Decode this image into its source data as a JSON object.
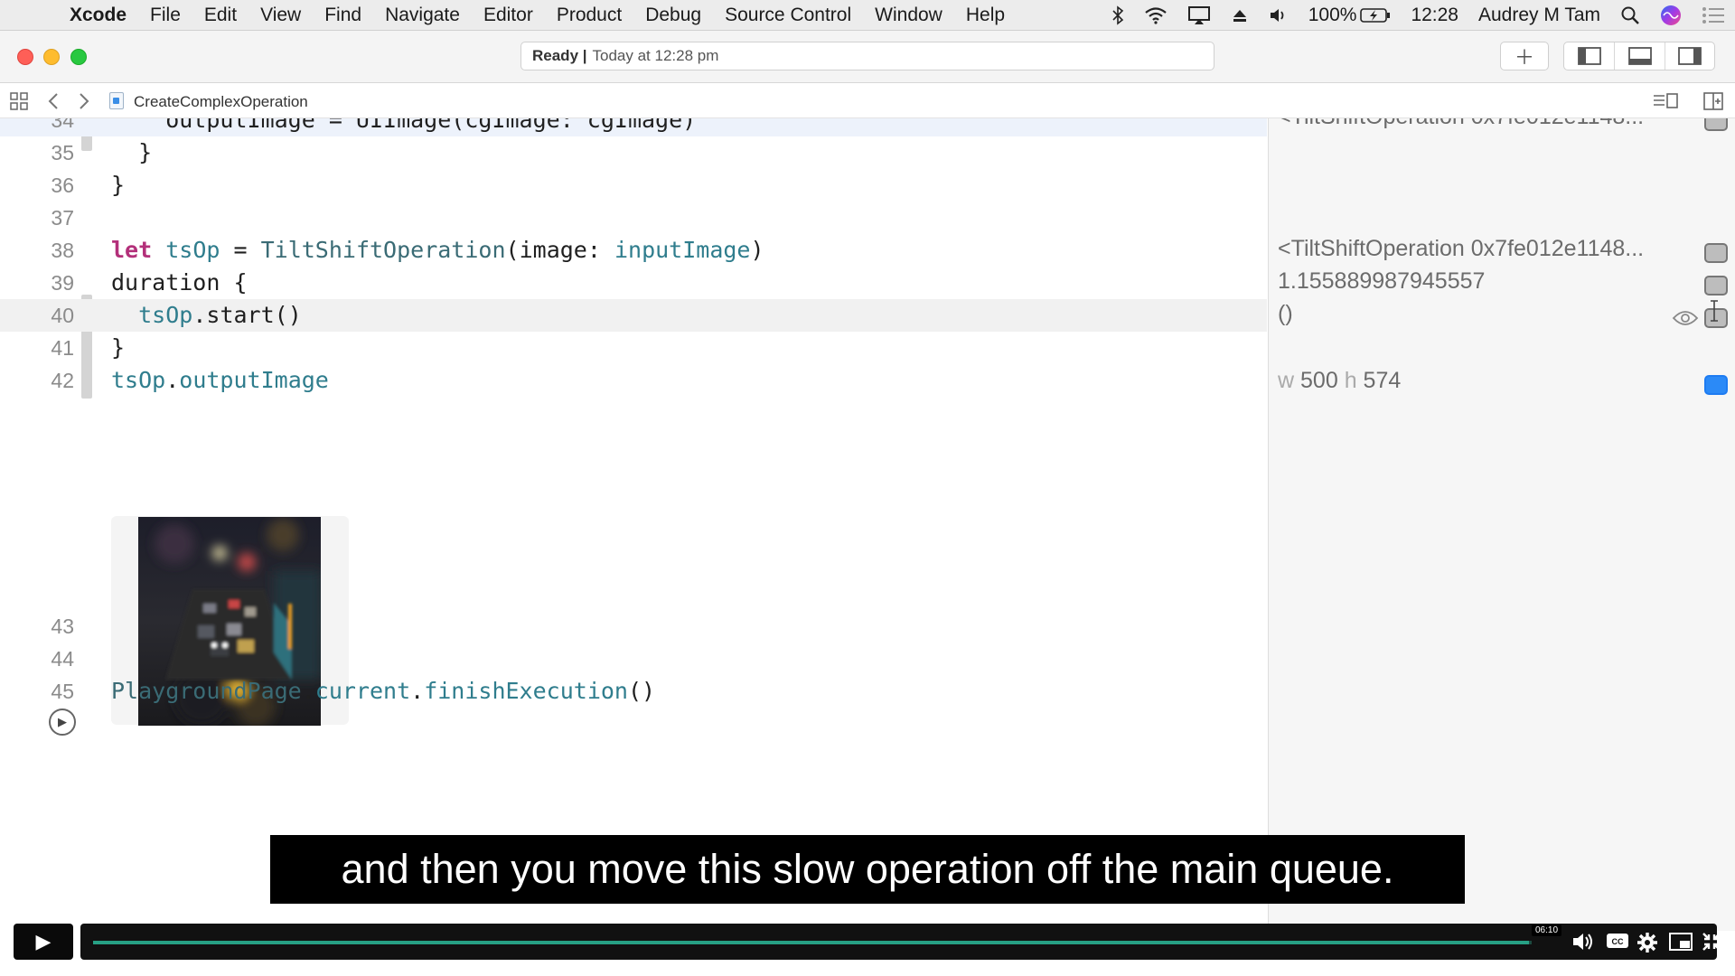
{
  "menubar": {
    "app_name": "Xcode",
    "items": [
      "File",
      "Edit",
      "View",
      "Find",
      "Navigate",
      "Editor",
      "Product",
      "Debug",
      "Source Control",
      "Window",
      "Help"
    ],
    "battery": "100%",
    "clock": "12:28",
    "user": "Audrey M Tam"
  },
  "toolbar": {
    "status_strong": "Ready |",
    "status_time": "Today at 12:28 pm"
  },
  "jumpbar": {
    "file_name": "CreateComplexOperation"
  },
  "editor": {
    "lines": [
      {
        "num": "34",
        "code": "    outputImage = UIImage(cgImage: cgImage)"
      },
      {
        "num": "35",
        "code": "  }"
      },
      {
        "num": "36",
        "code": "}"
      },
      {
        "num": "37",
        "code": ""
      },
      {
        "num": "38",
        "code": "let tsOp = TiltShiftOperation(image: inputImage)"
      },
      {
        "num": "39",
        "code": "duration {"
      },
      {
        "num": "40",
        "code": "  tsOp.start()"
      },
      {
        "num": "41",
        "code": "}"
      },
      {
        "num": "42",
        "code": "tsOp.outputImage"
      },
      {
        "num": "43",
        "code": ""
      },
      {
        "num": "44",
        "code": ""
      },
      {
        "num": "45",
        "code": "PlaygroundPage.current.finishExecution()"
      }
    ]
  },
  "results": {
    "row_top": "<TiltShiftOperation 0x7fe012e1148...",
    "row_op": "<TiltShiftOperation 0x7fe012e1148...",
    "row_duration": "1.155889987945557",
    "row_void": "()",
    "size_w_label": "w",
    "size_w": "500",
    "size_h_label": "h",
    "size_h": "574"
  },
  "video": {
    "caption": "and then you move this slow operation off the main queue.",
    "time_badge": "06:10",
    "progress": 0.998
  }
}
